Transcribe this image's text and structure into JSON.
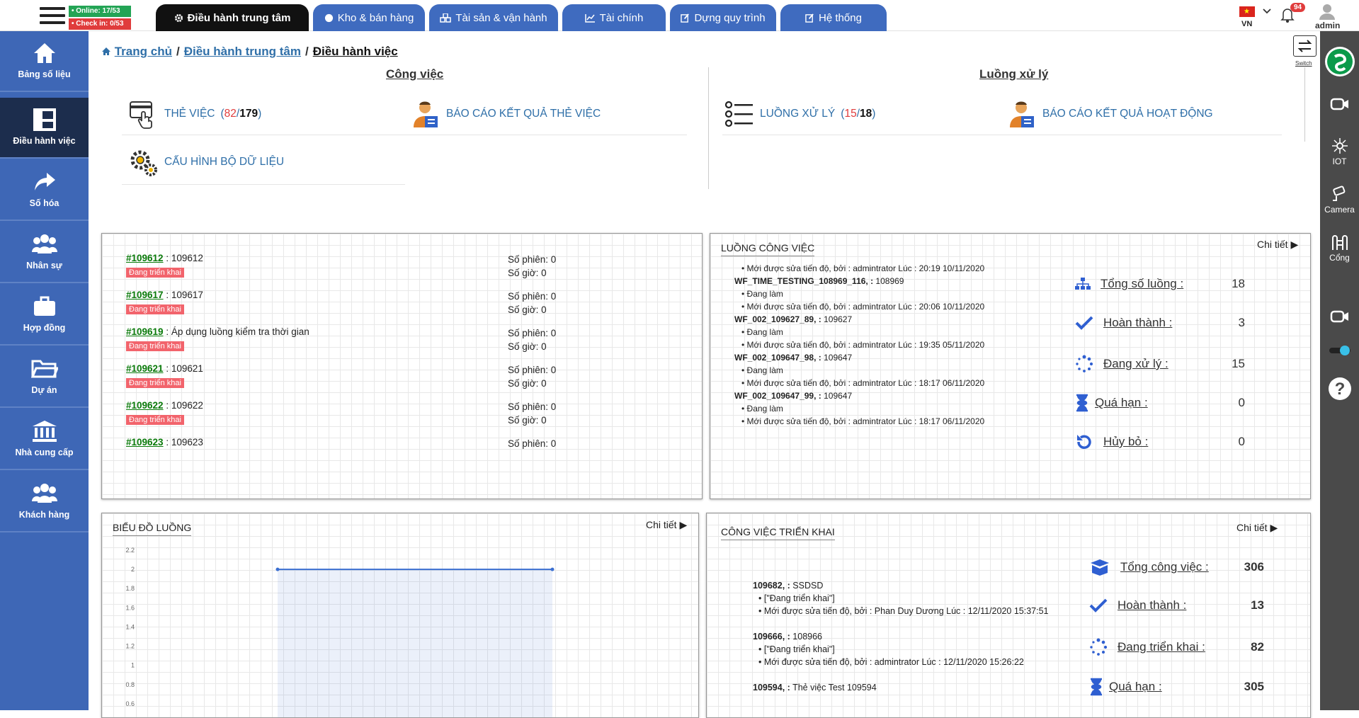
{
  "status": {
    "online": "• Online: 17/53",
    "checkin": "• Check in: 0/53"
  },
  "tabs": [
    {
      "label": "Điều hành trung tâm",
      "icon": "gear-icon",
      "active": true
    },
    {
      "label": "Kho & bán hàng",
      "icon": "globe-icon"
    },
    {
      "label": "Tài sản & vận hành",
      "icon": "cubes-icon"
    },
    {
      "label": "Tài chính",
      "icon": "chart-icon"
    },
    {
      "label": "Dựng quy trình",
      "icon": "edit-icon"
    },
    {
      "label": "Hệ thống",
      "icon": "edit-icon"
    }
  ],
  "header": {
    "lang": "VN",
    "notifications": "94",
    "user": "admin"
  },
  "sidebar": [
    {
      "label": "Bảng số liệu",
      "icon": "home-icon"
    },
    {
      "label": "Điều hành việc",
      "icon": "dashboard-icon",
      "active": true
    },
    {
      "label": "Số hóa",
      "icon": "share-icon"
    },
    {
      "label": "Nhân sự",
      "icon": "users-icon"
    },
    {
      "label": "Hợp đồng",
      "icon": "briefcase-icon"
    },
    {
      "label": "Dự án",
      "icon": "folder-icon"
    },
    {
      "label": "Nhà cung cấp",
      "icon": "bank-icon"
    },
    {
      "label": "Khách hàng",
      "icon": "users-icon"
    }
  ],
  "rightbar": [
    {
      "label": "",
      "icon": "video-chat-icon"
    },
    {
      "label": "IOT",
      "icon": "iot-icon"
    },
    {
      "label": "Camera",
      "icon": "camera-icon"
    },
    {
      "label": "Cổng",
      "icon": "gate-icon"
    },
    {
      "label": "",
      "icon": "video-chat-icon"
    },
    {
      "label": "",
      "icon": "toggle-icon"
    },
    {
      "label": "",
      "icon": "help-icon"
    }
  ],
  "switch_label": "Switch",
  "breadcrumb": [
    "Trang chủ",
    "Điều hành trung tâm",
    "Điều hành việc"
  ],
  "sections": {
    "congviec": "Công việc",
    "luong": "Luồng xử lý",
    "the_viec": {
      "label": "THẺ VIỆC",
      "count": "82",
      "total": "179"
    },
    "bao_cao_the_viec": "BÁO CÁO KẾT QUẢ THẺ VIỆC",
    "cau_hinh": "CẤU HÌNH BỘ DỮ LIỆU",
    "luong_xu_ly": {
      "label": "LUỒNG XỬ LÝ",
      "count": "15",
      "total": "18"
    },
    "bao_cao_hoat_dong": "BÁO CÁO KẾT QUẢ HOẠT ĐỘNG"
  },
  "tasks": [
    {
      "id": "#109612",
      "name": "109612",
      "badge": "Đang triển khai",
      "sessions": "Số phiên: 0",
      "hours": "Số giờ: 0"
    },
    {
      "id": "#109617",
      "name": "109617",
      "badge": "Đang triển khai",
      "sessions": "Số phiên: 0",
      "hours": "Số giờ: 0"
    },
    {
      "id": "#109619",
      "name": "Áp dụng luồng kiểm tra thời gian",
      "badge": "Đang triển khai",
      "sessions": "Số phiên: 0",
      "hours": "Số giờ: 0"
    },
    {
      "id": "#109621",
      "name": "109621",
      "badge": "Đang triển khai",
      "sessions": "Số phiên: 0",
      "hours": "Số giờ: 0"
    },
    {
      "id": "#109622",
      "name": "109622",
      "badge": "Đang triển khai",
      "sessions": "Số phiên: 0",
      "hours": "Số giờ: 0"
    },
    {
      "id": "#109623",
      "name": "109623",
      "badge": "",
      "sessions": "Số phiên: 0",
      "hours": ""
    }
  ],
  "workflow_panel": {
    "title": "LUỒNG CÔNG VIỆC",
    "detail": "Chi tiết",
    "lines": [
      {
        "name": "",
        "text": "• Mới được sửa tiến độ, bởi :  admintrator   Lúc :  20:19 10/11/2020"
      },
      {
        "name": "WF_TIME_TESTING_108969_116, :",
        "text": "  108969"
      },
      {
        "name": "",
        "text": "• Đang làm"
      },
      {
        "name": "",
        "text": "• Mới được sửa tiến độ, bởi :  admintrator   Lúc :  20:06 10/11/2020"
      },
      {
        "name": "WF_002_109627_89, :",
        "text": "  109627"
      },
      {
        "name": "",
        "text": "• Đang làm"
      },
      {
        "name": "",
        "text": "• Mới được sửa tiến độ, bởi :  admintrator   Lúc :  19:35 05/11/2020"
      },
      {
        "name": "WF_002_109647_98, :",
        "text": "  109647"
      },
      {
        "name": "",
        "text": "• Đang làm"
      },
      {
        "name": "",
        "text": "• Mới được sửa tiến độ, bởi :  admintrator   Lúc :  18:17 06/11/2020"
      },
      {
        "name": "WF_002_109647_99, :",
        "text": "  109647"
      },
      {
        "name": "",
        "text": "• Đang làm"
      },
      {
        "name": "",
        "text": "• Mới được sửa tiến độ, bởi :  admintrator   Lúc :  18:17 06/11/2020"
      }
    ],
    "stats": [
      {
        "label": "Tổng số luồng :",
        "value": "18",
        "icon": "sitemap-icon"
      },
      {
        "label": "Hoàn thành :",
        "value": "3",
        "icon": "check-icon"
      },
      {
        "label": "Đang xử lý :",
        "value": "15",
        "icon": "spinner-icon"
      },
      {
        "label": "Quá hạn :",
        "value": "0",
        "icon": "hourglass-icon"
      },
      {
        "label": "Hủy bỏ :",
        "value": "0",
        "icon": "undo-icon"
      }
    ]
  },
  "chart_panel": {
    "title": "BIỂU ĐỒ LUỒNG",
    "detail": "Chi tiết"
  },
  "chart_data": {
    "type": "area",
    "x": [
      0,
      1
    ],
    "series": [
      {
        "values": [
          2,
          2
        ]
      }
    ],
    "yticks": [
      "2.2",
      "2",
      "1.8",
      "1.6",
      "1.4",
      "1.2",
      "1",
      "0.8",
      "0.6"
    ],
    "ylim": [
      0.4,
      2.2
    ],
    "color": "#3b6fd1"
  },
  "deploy_panel": {
    "title": "CÔNG VIỆC TRIỂN KHAI",
    "detail": "Chi tiết",
    "lines": [
      {
        "name": "109682, :",
        "text": "  SSDSD"
      },
      {
        "name": "",
        "text": "  • [\"Đang triển khai\"]"
      },
      {
        "name": "",
        "text": "  • Mới được sửa tiến độ, bởi :  Phan Duy Dương   Lúc :  12/11/2020 15:37:51"
      },
      {
        "name": "",
        "text": " "
      },
      {
        "name": "109666, :",
        "text": "  108966"
      },
      {
        "name": "",
        "text": "  • [\"Đang triển khai\"]"
      },
      {
        "name": "",
        "text": "  • Mới được sửa tiến độ, bởi :  admintrator   Lúc :  12/11/2020 15:26:22"
      },
      {
        "name": "",
        "text": " "
      },
      {
        "name": "109594, :",
        "text": "  Thẻ việc Test 109594"
      }
    ],
    "stats": [
      {
        "label": "Tổng công việc :",
        "value": "306",
        "icon": "box-icon"
      },
      {
        "label": "Hoàn thành :",
        "value": "13",
        "icon": "check-icon"
      },
      {
        "label": "Đang triển khai :",
        "value": "82",
        "icon": "spinner-icon"
      },
      {
        "label": "Quá hạn :",
        "value": "305",
        "icon": "hourglass-icon"
      }
    ]
  }
}
